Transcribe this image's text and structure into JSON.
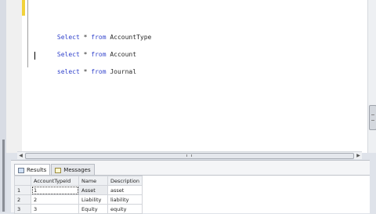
{
  "editor": {
    "lines": [
      {
        "keyword1": "Select",
        "rest1": " * ",
        "keyword2": "from",
        "table": " AccountType"
      },
      {
        "keyword1": "Select",
        "rest1": " * ",
        "keyword2": "from",
        "table": " Account"
      },
      {
        "keyword1": "select",
        "rest1": " * ",
        "keyword2": "from",
        "table": " Journal"
      }
    ]
  },
  "results": {
    "tabs": [
      {
        "label": "Results",
        "icon": "grid-icon",
        "active": true
      },
      {
        "label": "Messages",
        "icon": "messages-icon",
        "active": false
      }
    ],
    "columns": [
      "AccountTypeId",
      "Name",
      "Description"
    ],
    "rows": [
      {
        "num": "1",
        "id": "1",
        "name": "Asset",
        "desc": "asset"
      },
      {
        "num": "2",
        "id": "2",
        "name": "Liability",
        "desc": "liability"
      },
      {
        "num": "3",
        "id": "3",
        "name": "Equity",
        "desc": "equity"
      }
    ]
  },
  "colors": {
    "keyword": "#3344cc",
    "changebar": "#f2d23a"
  }
}
